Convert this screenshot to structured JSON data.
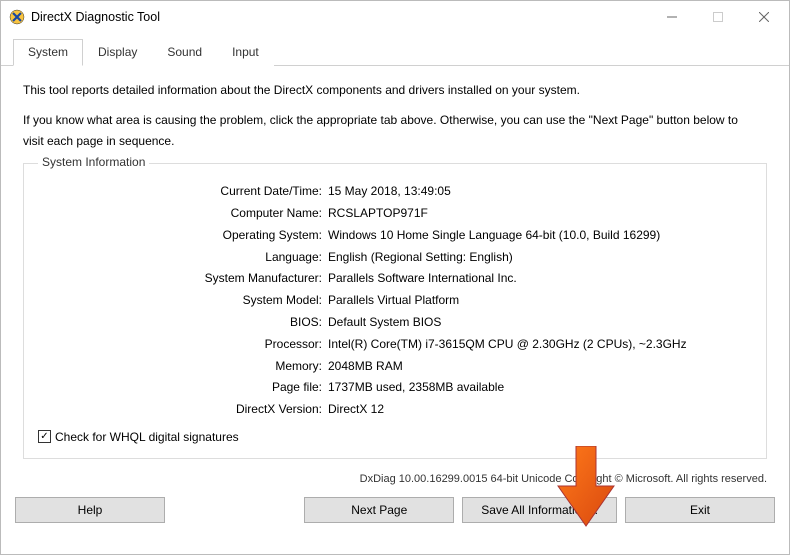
{
  "window": {
    "title": "DirectX Diagnostic Tool"
  },
  "tabs": {
    "system": "System",
    "display": "Display",
    "sound": "Sound",
    "input": "Input"
  },
  "intro": {
    "line1": "This tool reports detailed information about the DirectX components and drivers installed on your system.",
    "line2": "If you know what area is causing the problem, click the appropriate tab above.  Otherwise, you can use the \"Next Page\" button below to visit each page in sequence."
  },
  "sysinfo": {
    "legend": "System Information",
    "labels": {
      "datetime": "Current Date/Time:",
      "computer": "Computer Name:",
      "os": "Operating System:",
      "lang": "Language:",
      "manufacturer": "System Manufacturer:",
      "model": "System Model:",
      "bios": "BIOS:",
      "processor": "Processor:",
      "memory": "Memory:",
      "pagefile": "Page file:",
      "dxver": "DirectX Version:"
    },
    "values": {
      "datetime": "15 May 2018, 13:49:05",
      "computer": "RCSLAPTOP971F",
      "os": "Windows 10 Home Single Language 64-bit (10.0, Build 16299)",
      "lang": "English (Regional Setting: English)",
      "manufacturer": "Parallels Software International Inc.",
      "model": "Parallels Virtual Platform",
      "bios": "Default System BIOS",
      "processor": "Intel(R) Core(TM) i7-3615QM CPU @ 2.30GHz (2 CPUs), ~2.3GHz",
      "memory": "2048MB RAM",
      "pagefile": "1737MB used, 2358MB available",
      "dxver": "DirectX 12"
    },
    "check_label": "Check for WHQL digital signatures"
  },
  "footer": "DxDiag 10.00.16299.0015 64-bit Unicode Copyright © Microsoft. All rights reserved.",
  "buttons": {
    "help": "Help",
    "next": "Next Page",
    "saveall": "Save All Information...",
    "exit": "Exit"
  }
}
